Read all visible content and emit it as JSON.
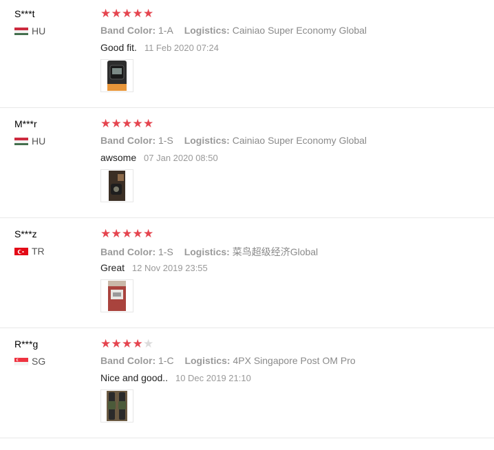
{
  "labels": {
    "band_color": "Band Color:",
    "logistics": "Logistics:"
  },
  "reviews": [
    {
      "user": "S***t",
      "country": "HU",
      "flag": "hungary",
      "rating": 5,
      "band_color": "1-A",
      "logistics": "Cainiao Super Economy Global",
      "text": "Good fit.",
      "date": "11 Feb 2020 07:24",
      "image": "watch-photo-orange"
    },
    {
      "user": "M***r",
      "country": "HU",
      "flag": "hungary",
      "rating": 5,
      "band_color": "1-S",
      "logistics": "Cainiao Super Economy Global",
      "text": "awsome",
      "date": "07 Jan 2020 08:50",
      "image": "watch-photo-hand"
    },
    {
      "user": "S***z",
      "country": "TR",
      "flag": "turkey",
      "rating": 5,
      "band_color": "1-S",
      "logistics": "菜鸟超级经济Global",
      "text": "Great",
      "date": "12 Nov 2019 23:55",
      "image": "watch-photo-package"
    },
    {
      "user": "R***g",
      "country": "SG",
      "flag": "singapore",
      "rating": 4,
      "band_color": "1-C",
      "logistics": "4PX Singapore Post OM Pro",
      "text": "Nice and good..",
      "date": "10 Dec 2019 21:10",
      "image": "watch-photo-pair"
    }
  ],
  "colors": {
    "star_on": "#e5454f",
    "star_off": "#dcdcdc"
  }
}
